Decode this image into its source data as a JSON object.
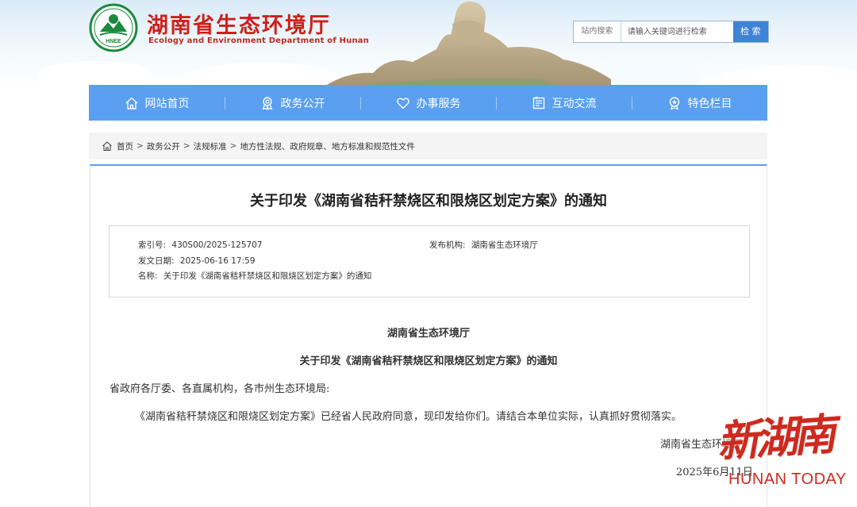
{
  "header": {
    "logo_text": "HNEE",
    "title": "湖南省生态环境厅",
    "subtitle": "Ecology and Environment Department of Hunan"
  },
  "search": {
    "scope": "站内搜索",
    "placeholder": "请输入关键词进行检索",
    "button": "检 索"
  },
  "nav": {
    "items": [
      {
        "label": "网站首页",
        "icon": "home-icon"
      },
      {
        "label": "政务公开",
        "icon": "badge-icon"
      },
      {
        "label": "办事服务",
        "icon": "heart-icon"
      },
      {
        "label": "互动交流",
        "icon": "document-icon"
      },
      {
        "label": "特色栏目",
        "icon": "star-badge-icon"
      }
    ]
  },
  "breadcrumb": {
    "items": [
      "首页",
      "政务公开",
      "法规标准",
      "地方性法规、政府规章、地方标准和规范性文件"
    ],
    "separator": ">"
  },
  "article": {
    "title": "关于印发《湖南省秸秆禁烧区和限烧区划定方案》的通知",
    "meta": {
      "index_label": "索引号:",
      "index_value": "430S00/2025-125707",
      "publisher_label": "发布机构:",
      "publisher_value": "湖南省生态环境厅",
      "date_label": "发文日期:",
      "date_value": "2025-06-16 17:59",
      "name_label": "名称:",
      "name_value": "关于印发《湖南省秸秆禁烧区和限烧区划定方案》的通知"
    },
    "body": {
      "org_heading": "湖南省生态环境厅",
      "doc_heading": "关于印发《湖南省秸秆禁烧区和限烧区划定方案》的通知",
      "salutation": "省政府各厅委、各直属机构，各市州生态环境局:",
      "paragraph": "《湖南省秸秆禁烧区和限烧区划定方案》已经省人民政府同意，现印发给你们。请结合本单位实际，认真抓好贯彻落实。",
      "signature": "湖南省生态环境厅",
      "sign_date": "2025年6月11日"
    }
  },
  "watermark": {
    "zh": "新湖南",
    "en": "HUNAN TODAY"
  },
  "colors": {
    "brand_red": "#d01f1a",
    "nav_blue": "#5a9ff0",
    "button_blue": "#3f83d4"
  }
}
